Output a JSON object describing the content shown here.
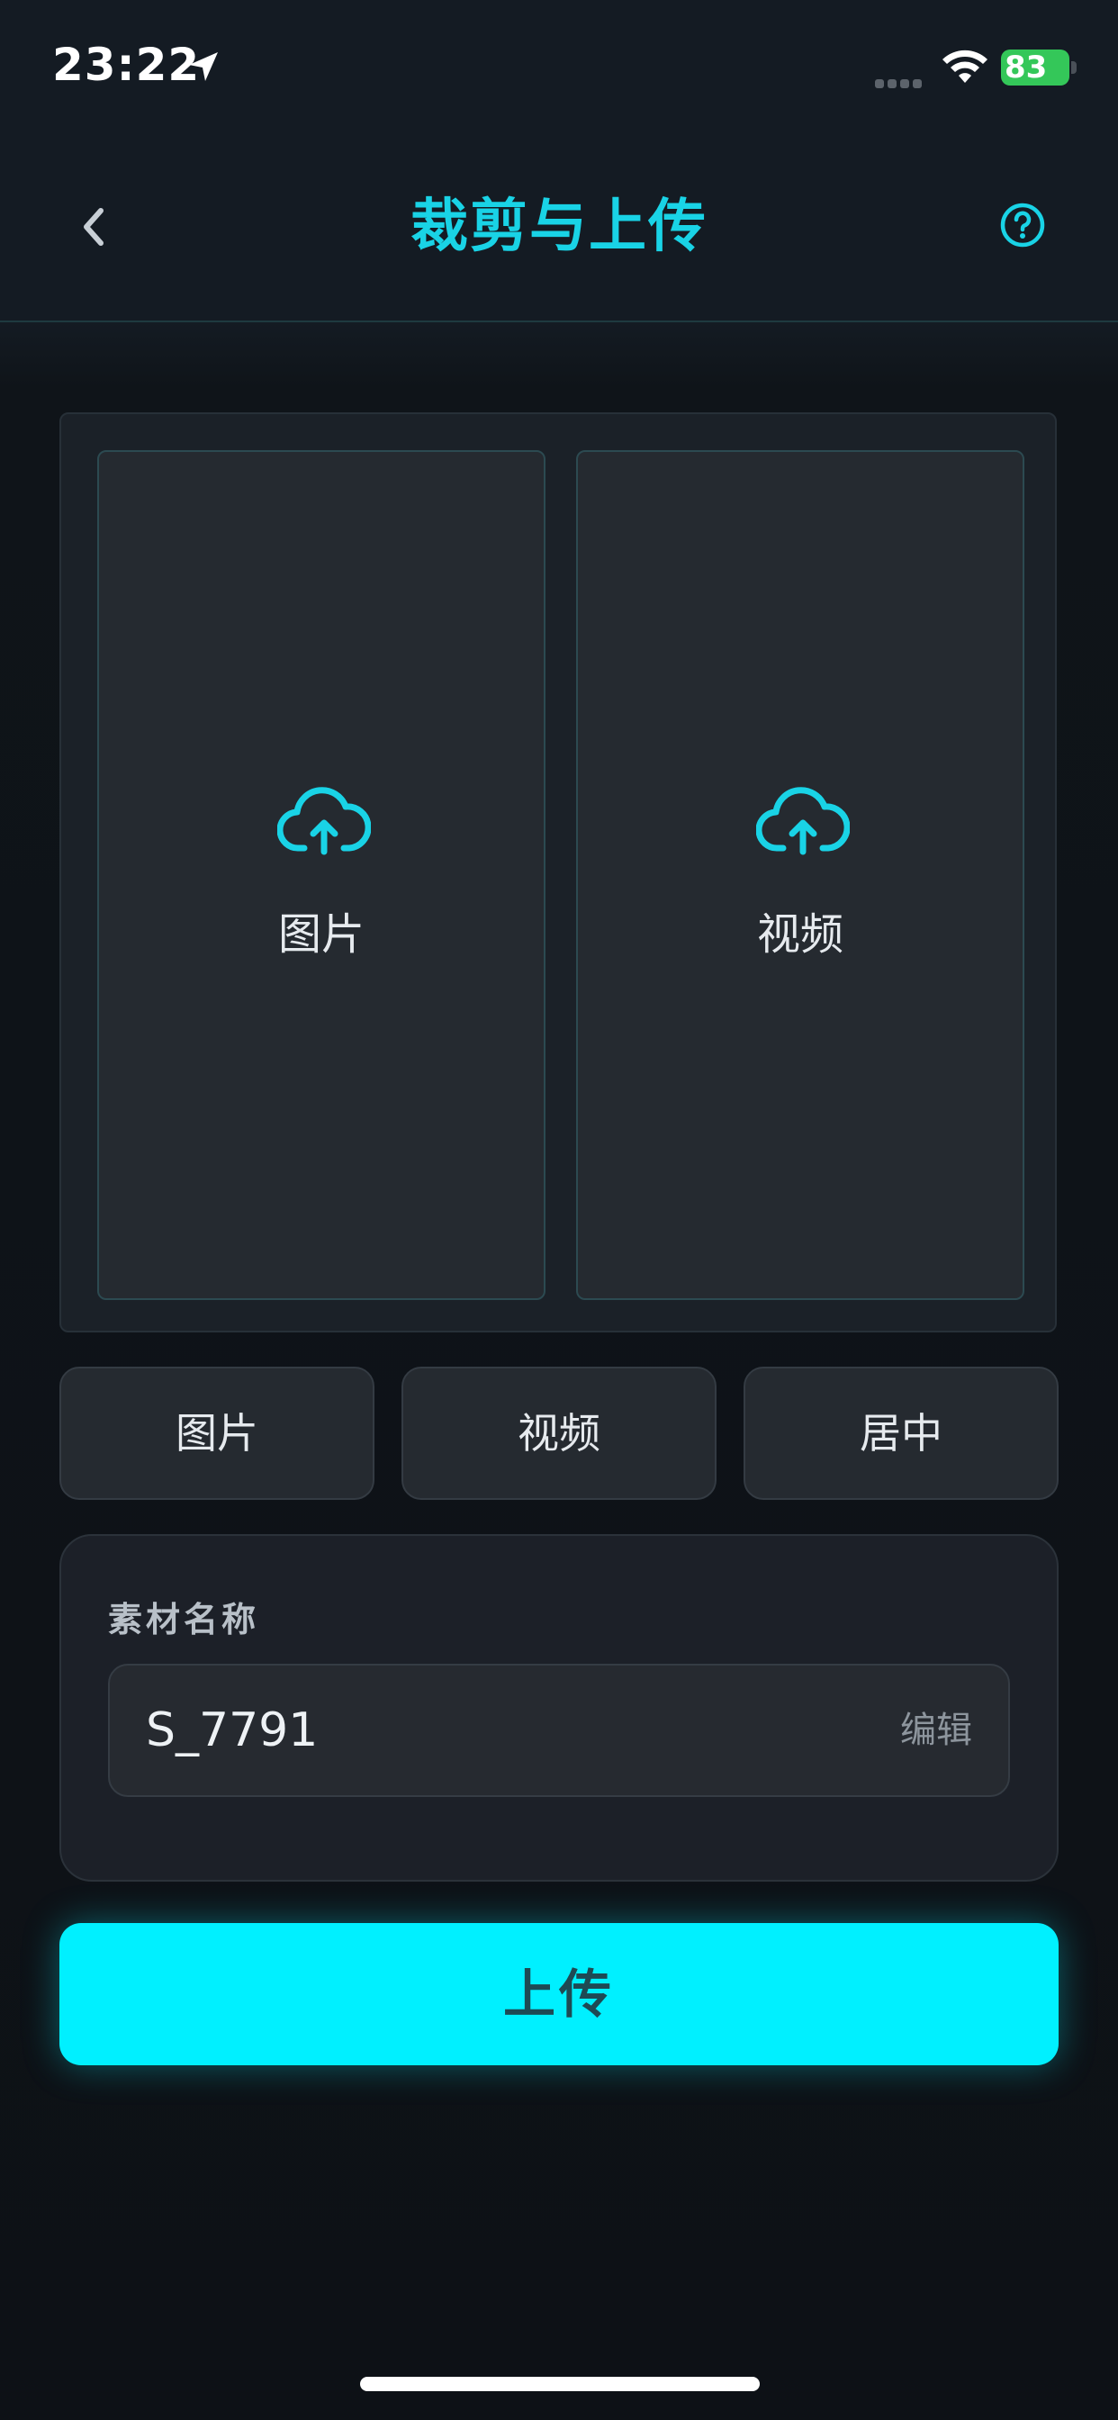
{
  "status_bar": {
    "time": "23:22",
    "battery": "83"
  },
  "header": {
    "title": "裁剪与上传"
  },
  "preview": {
    "slots": [
      {
        "label": "图片",
        "icon": "cloud-upload-icon"
      },
      {
        "label": "视频",
        "icon": "cloud-upload-icon"
      }
    ]
  },
  "options": [
    {
      "label": "图片"
    },
    {
      "label": "视频"
    },
    {
      "label": "居中"
    }
  ],
  "material": {
    "label": "素材名称",
    "value": "S_7791",
    "edit_label": "编辑"
  },
  "upload": {
    "label": "上传"
  },
  "colors": {
    "accent": "#00f0ff",
    "title": "#19d3e6",
    "background": "#0f1419"
  }
}
